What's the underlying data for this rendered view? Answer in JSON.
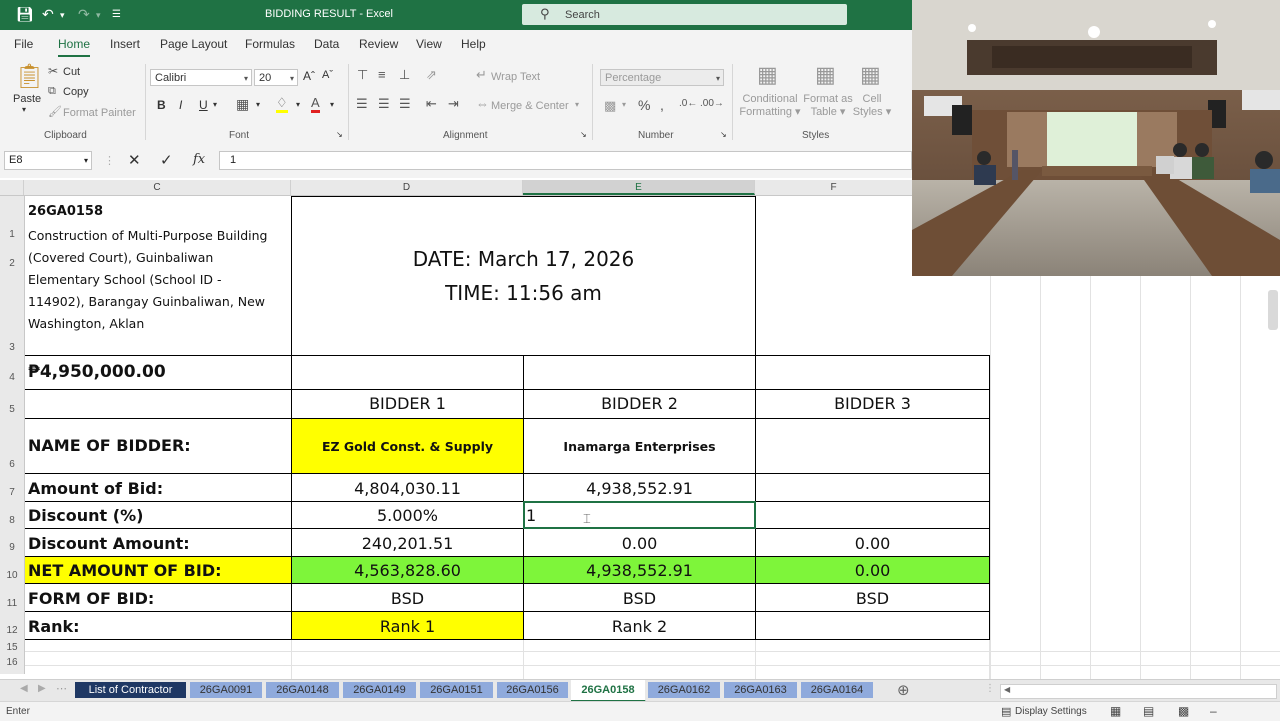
{
  "window": {
    "title": "BIDDING RESULT  -  Excel",
    "search_placeholder": "Search"
  },
  "menu": [
    "File",
    "Home",
    "Insert",
    "Page Layout",
    "Formulas",
    "Data",
    "Review",
    "View",
    "Help"
  ],
  "ribbon": {
    "clipboard": {
      "paste": "Paste",
      "cut": "Cut",
      "copy": "Copy",
      "format_painter": "Format Painter",
      "group": "Clipboard"
    },
    "font": {
      "name": "Calibri",
      "size": "20",
      "bold": "B",
      "italic": "I",
      "underline": "U",
      "group": "Font"
    },
    "alignment": {
      "wrap": "Wrap Text",
      "merge": "Merge & Center",
      "group": "Alignment"
    },
    "number": {
      "format": "Percentage",
      "group": "Number"
    },
    "styles": {
      "conditional": [
        "Conditional",
        "Formatting"
      ],
      "format_table": [
        "Format as",
        "Table"
      ],
      "cell_styles": [
        "Cell",
        "Styles"
      ],
      "group": "Styles"
    }
  },
  "formula_bar": {
    "name_box": "E8",
    "fx": "fx",
    "content": "1"
  },
  "columns": [
    "C",
    "D",
    "E",
    "F"
  ],
  "rows": [
    "1",
    "2",
    "3",
    "4",
    "5",
    "6",
    "7",
    "8",
    "9",
    "10",
    "11",
    "12",
    "15",
    "16"
  ],
  "sheet": {
    "project_code": "26GA0158",
    "project_lines": [
      "Construction of Multi-Purpose Building",
      "(Covered Court), Guinbaliwan",
      "Elementary School (School ID -",
      "114902), Barangay Guinbaliwan, New",
      "Washington, Aklan"
    ],
    "date": "DATE: March 17, 2026",
    "time": "TIME: 11:56 am",
    "budget": "₱4,950,000.00",
    "bidder_headers": [
      "BIDDER 1",
      "BIDDER 2",
      "BIDDER 3"
    ],
    "rows": {
      "name_label": "NAME OF BIDDER:",
      "names": [
        "EZ Gold Const. & Supply",
        "Inamarga Enterprises",
        ""
      ],
      "amount_label": "Amount of Bid:",
      "amounts": [
        "4,804,030.11",
        "4,938,552.91",
        ""
      ],
      "discount_label": "Discount (%)",
      "discounts": [
        "5.000%",
        "1",
        ""
      ],
      "discount_amt_label": "Discount Amount:",
      "discount_amts": [
        "240,201.51",
        "0.00",
        "0.00"
      ],
      "net_label": "NET AMOUNT OF BID:",
      "nets": [
        "4,563,828.60",
        "4,938,552.91",
        "0.00"
      ],
      "form_label": "FORM OF BID:",
      "forms": [
        "BSD",
        "BSD",
        "BSD"
      ],
      "rank_label": "Rank:",
      "ranks": [
        "Rank 1",
        "Rank 2",
        ""
      ]
    }
  },
  "sheet_tabs": [
    "List of Contractor",
    "26GA0091",
    "26GA0148",
    "26GA0149",
    "26GA0151",
    "26GA0156",
    "26GA0158",
    "26GA0162",
    "26GA0163",
    "26GA0164"
  ],
  "active_tab": "26GA0158",
  "status": {
    "mode": "Enter",
    "display_settings": "Display Settings"
  },
  "colors": {
    "excel_green": "#1f7244",
    "highlight_yellow": "#ffff00",
    "net_green": "#7ef53a",
    "tab_blue": "#8faadc"
  }
}
